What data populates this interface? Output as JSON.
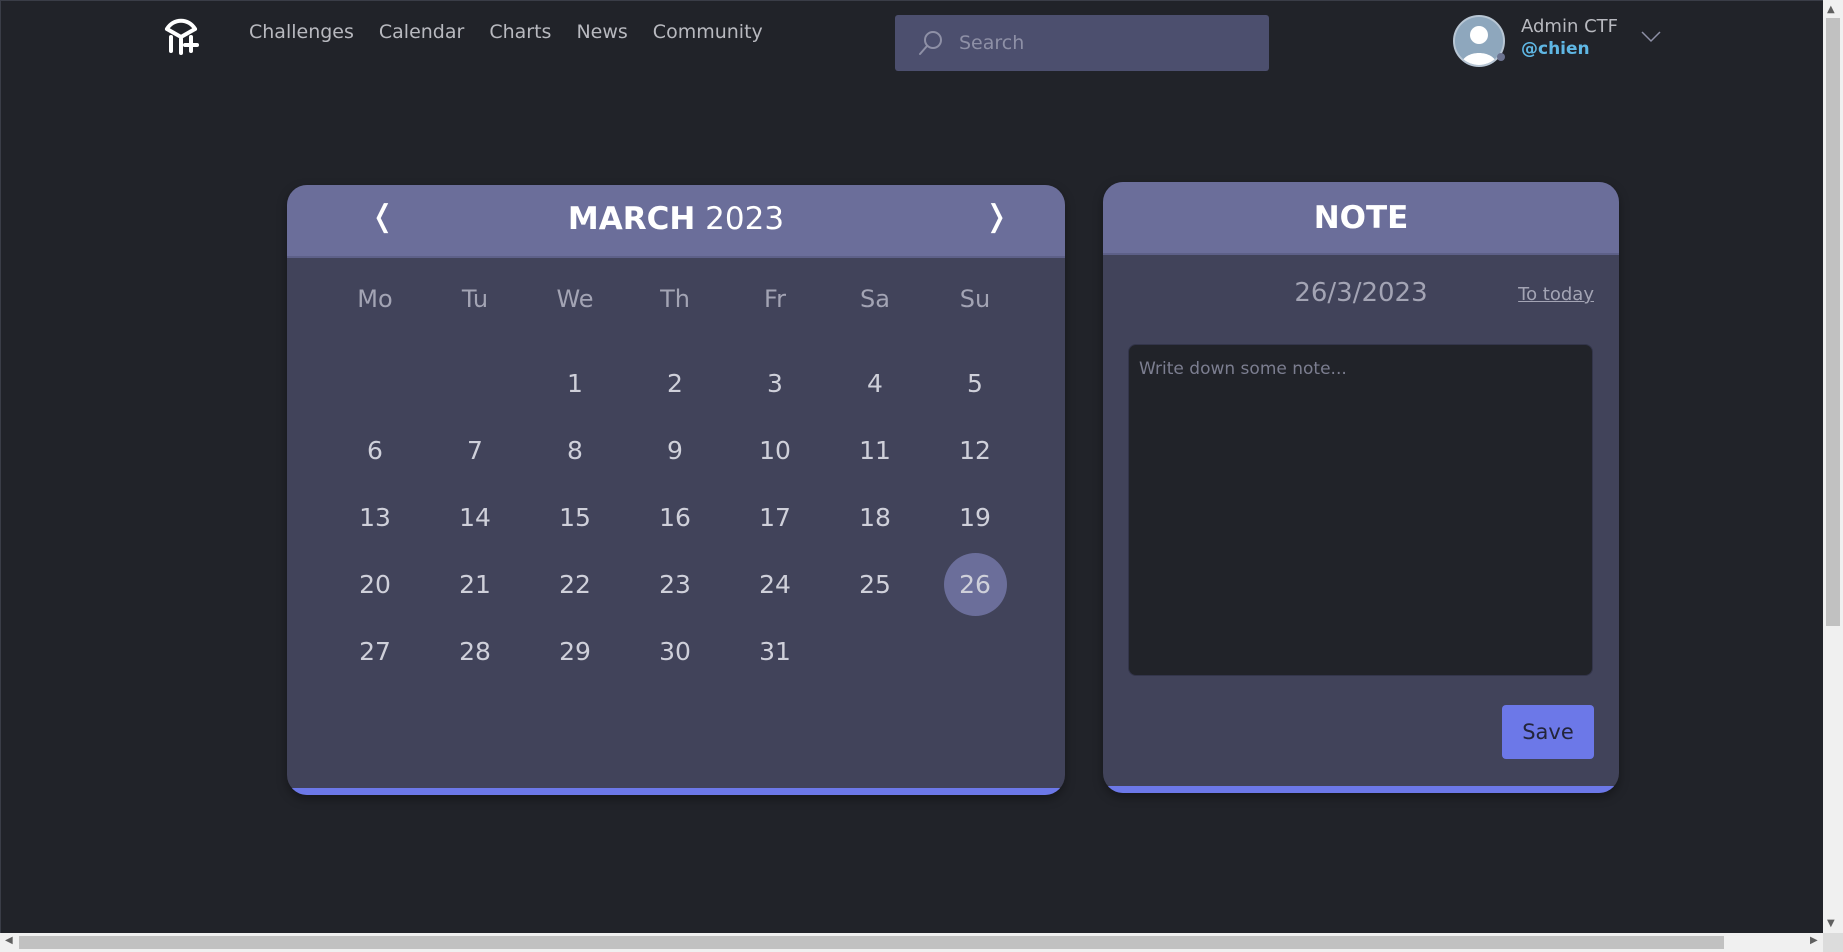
{
  "header": {
    "nav": [
      "Challenges",
      "Calendar",
      "Charts",
      "News",
      "Community"
    ],
    "search_placeholder": "Search",
    "user": {
      "name": "Admin CTF",
      "handle": "@chien"
    }
  },
  "calendar": {
    "prev_label": "❬",
    "next_label": "❭",
    "month": "MARCH",
    "year": "2023",
    "weekdays": [
      "Mo",
      "Tu",
      "We",
      "Th",
      "Fr",
      "Sa",
      "Su"
    ],
    "leading_blanks": 2,
    "days_in_month": 31,
    "selected_day": 26
  },
  "note": {
    "title": "NOTE",
    "date": "26/3/2023",
    "to_today": "To today",
    "textarea_placeholder": "Write down some note...",
    "save_label": "Save"
  },
  "colors": {
    "background": "#212329",
    "card": "#41435a",
    "card_header": "#6b6e9a",
    "accent": "#6c78e8",
    "handle": "#5fb7e4"
  }
}
